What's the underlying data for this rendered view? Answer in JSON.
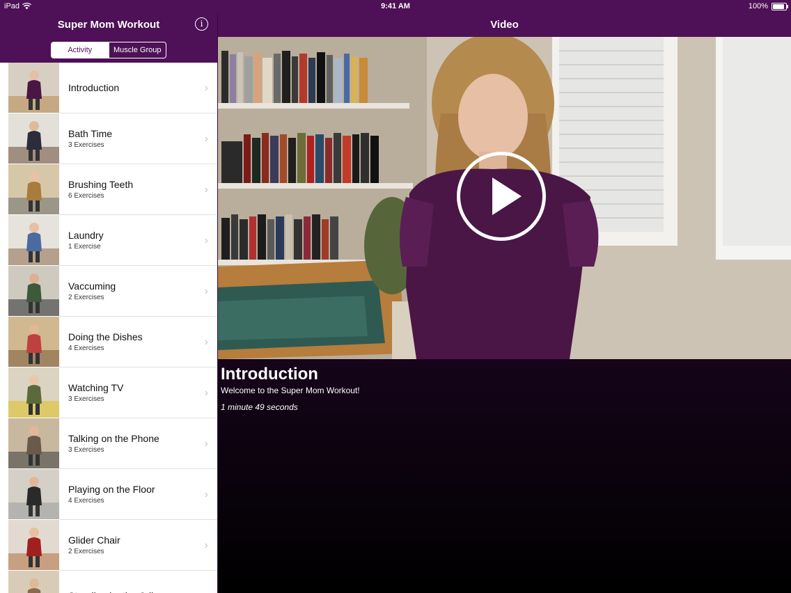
{
  "status_bar": {
    "device": "iPad",
    "time": "9:41 AM",
    "battery": "100%",
    "battery_level": 1.0
  },
  "sidebar": {
    "title": "Super Mom Workout",
    "info_icon": "info-circle-icon",
    "segments": [
      {
        "label": "Activity",
        "selected": true
      },
      {
        "label": "Muscle Group",
        "selected": false
      }
    ],
    "items": [
      {
        "title": "Introduction",
        "subtitle": ""
      },
      {
        "title": "Bath Time",
        "subtitle": "3 Exercises"
      },
      {
        "title": "Brushing Teeth",
        "subtitle": "6 Exercises"
      },
      {
        "title": "Laundry",
        "subtitle": "1 Exercise"
      },
      {
        "title": "Vaccuming",
        "subtitle": "2 Exercises"
      },
      {
        "title": "Doing the Dishes",
        "subtitle": "4 Exercises"
      },
      {
        "title": "Watching TV",
        "subtitle": "3 Exercises"
      },
      {
        "title": "Talking on the Phone",
        "subtitle": "3 Exercises"
      },
      {
        "title": "Playing on the Floor",
        "subtitle": "4 Exercises"
      },
      {
        "title": "Glider Chair",
        "subtitle": "2 Exercises"
      },
      {
        "title": "Standing by the Crib",
        "subtitle": ""
      }
    ]
  },
  "detail": {
    "title": "Video",
    "video_title": "Introduction",
    "description": "Welcome to the Super Mom Workout!",
    "duration": "1 minute 49 seconds",
    "play_icon": "play-circle-icon"
  },
  "colors": {
    "nav_purple": "#4e1056",
    "detail_bg_top": "#3d0b44",
    "detail_bg_bottom": "#000000"
  }
}
